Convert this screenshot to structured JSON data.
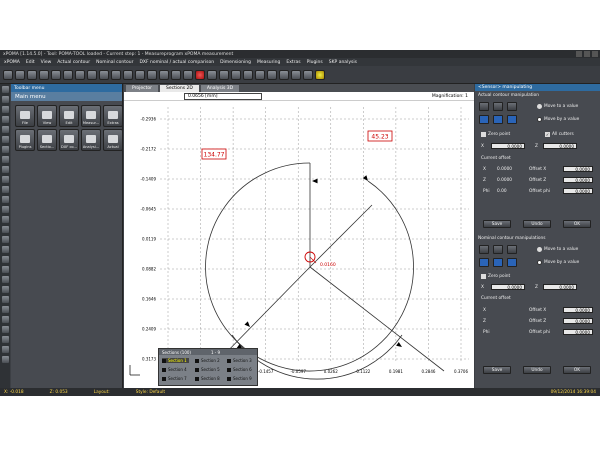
{
  "window": {
    "title": "xPOMA [1.14.5.0] - Tool: POMA-TOOL loaded - Current step: 1 - Measureprogram xPOMA measurement"
  },
  "menu": [
    "xPOMA",
    "Edit",
    "View",
    "Actual contour",
    "Nominal contour",
    "DXF nominal / actual comparison",
    "Dimensioning",
    "Measuring",
    "Extras",
    "Plugins",
    "SKP analysis"
  ],
  "tool_menu": {
    "title": "Toolbar menu",
    "main": "Main menu",
    "buttons": [
      "File",
      "View",
      "Edit",
      "Measur...",
      "Extras",
      "Plugins",
      "Sectio...",
      "DXF co...",
      "Analysi...",
      "Actual"
    ]
  },
  "tabs": [
    "Projector",
    "Sections 2D",
    "Analysis 3D"
  ],
  "view": {
    "value": "0.0656 [mm]",
    "magnification": "Magnification: 1"
  },
  "chart_data": {
    "type": "scatter",
    "y_ticks": [
      "-0.2936",
      "-0.2172",
      "-0.1409",
      "-0.0645",
      "0.0119",
      "0.0882",
      "0.1646",
      "0.2409",
      "0.3173"
    ],
    "x_ticks": [
      "-0.8035",
      "-0.5176",
      "-0.2318",
      "-0.1457",
      "-0.0597",
      "0.0262",
      "0.1122",
      "0.1981",
      "0.2846",
      "0.3706"
    ],
    "angles": {
      "a1": "45.23",
      "a2": "134.77",
      "a3": "90.24"
    },
    "center_label": "0.0160",
    "grid": true
  },
  "sections": {
    "title": "Sections (100)",
    "range": "1 - 9",
    "items": [
      "Section 1",
      "Section 2",
      "Section 3",
      "Section 4",
      "Section 5",
      "Section 6",
      "Section 7",
      "Section 8",
      "Section 9"
    ]
  },
  "right": {
    "header": "<Sensor> manipulating",
    "actual": {
      "title": "Actual contour manipulation",
      "opt1": "Move to a value",
      "opt2": "Move by a value",
      "zero": "Zero point",
      "all": "All cutters",
      "x_label": "X",
      "x_val": "0.0000",
      "z_label": "Z",
      "z_val": "0.0000",
      "offset_title": "Current offset",
      "rows": [
        [
          "X",
          "0.0000",
          "Offset X",
          "0.0000"
        ],
        [
          "Z",
          "0.0000",
          "Offset Z",
          "0.0000"
        ],
        [
          "Phi",
          "0.00",
          "Offset phi",
          "0.0000"
        ]
      ],
      "buttons": [
        "Save",
        "Undo",
        "OK"
      ]
    },
    "nominal": {
      "title": "Nominal contour manipulations",
      "opt1": "Move to a value",
      "opt2": "Move by a value",
      "zero": "Zero point",
      "x_label": "X",
      "x_val": "0.0000",
      "z_label": "Z",
      "z_val": "0.0000",
      "offset_title": "Current offset",
      "rows": [
        [
          "X",
          "",
          "Offset X",
          "0.0000"
        ],
        [
          "Z",
          "",
          "Offset Z",
          "0.0000"
        ],
        [
          "Phi",
          "",
          "Offset phi",
          "0.0000"
        ]
      ],
      "buttons": [
        "Save",
        "Undo",
        "OK"
      ]
    }
  },
  "status": {
    "x": "X: -0.018",
    "z": "Z: 0.053",
    "layout": "Layout:",
    "style": "Style: Default",
    "datetime": "09/12/2014 16:39:04"
  }
}
